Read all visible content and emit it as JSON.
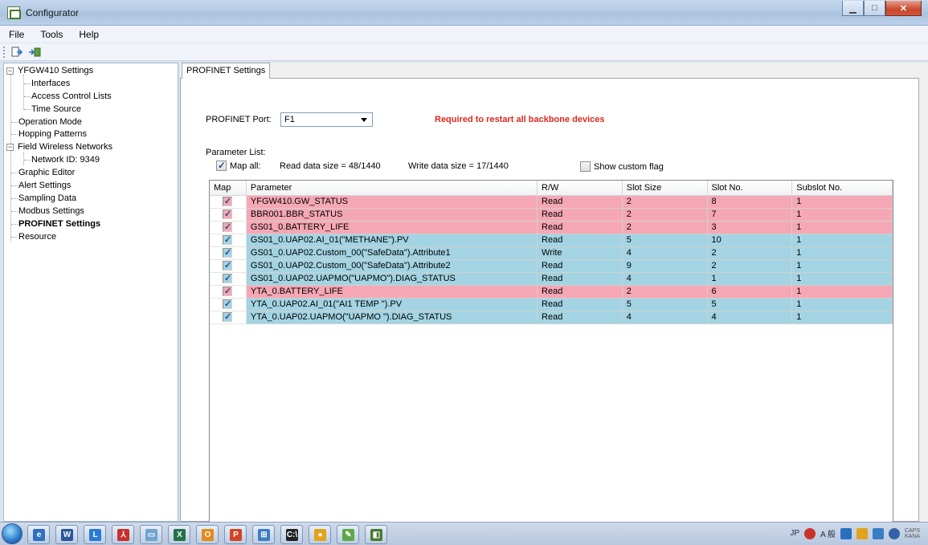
{
  "window": {
    "title": "Configurator",
    "min_icon": "minimize-icon",
    "max_icon": "maximize-icon",
    "close_icon": "close-icon"
  },
  "menu": [
    "File",
    "Tools",
    "Help"
  ],
  "toolbar": {
    "icons": [
      "import-icon",
      "export-icon"
    ]
  },
  "tree": {
    "items": [
      {
        "label": "YFGW410 Settings",
        "expander": "−"
      },
      {
        "label": "Interfaces"
      },
      {
        "label": "Access Control Lists"
      },
      {
        "label": "Time Source"
      },
      {
        "label": "Operation Mode"
      },
      {
        "label": "Hopping Patterns"
      },
      {
        "label": "Field Wireless Networks",
        "expander": "−"
      },
      {
        "label": "Network ID: 9349"
      },
      {
        "label": "Graphic Editor"
      },
      {
        "label": "Alert Settings"
      },
      {
        "label": "Sampling Data"
      },
      {
        "label": "Modbus Settings"
      },
      {
        "label": "PROFINET Settings",
        "selected": true
      },
      {
        "label": "Resource"
      }
    ]
  },
  "tab": {
    "label": "PROFINET Settings"
  },
  "profinet": {
    "port_label": "PROFINET Port:",
    "port_value": "F1",
    "warning": "Required to restart all backbone devices",
    "param_list_label": "Parameter List:",
    "map_all_label": "Map all:",
    "map_all_checked": true,
    "read_size": "Read data size =  48/1440",
    "write_size": "Write data size =  17/1440",
    "custom_flag_label": "Show custom flag",
    "custom_flag_checked": false
  },
  "table": {
    "headers": [
      "Map",
      "Parameter",
      "R/W",
      "Slot Size",
      "Slot No.",
      "Subslot No."
    ],
    "rows": [
      {
        "param": "YFGW410.GW_STATUS",
        "rw": "Read",
        "size": "2",
        "slot": "8",
        "sub": "1",
        "color": "pink"
      },
      {
        "param": "BBR001.BBR_STATUS",
        "rw": "Read",
        "size": "2",
        "slot": "7",
        "sub": "1",
        "color": "pink"
      },
      {
        "param": "GS01_0.BATTERY_LIFE",
        "rw": "Read",
        "size": "2",
        "slot": "3",
        "sub": "1",
        "color": "pink"
      },
      {
        "param": "GS01_0.UAP02.AI_01(\"METHANE\").PV",
        "rw": "Read",
        "size": "5",
        "slot": "10",
        "sub": "1",
        "color": "blue"
      },
      {
        "param": "GS01_0.UAP02.Custom_00(\"SafeData\").Attribute1",
        "rw": "Write",
        "size": "4",
        "slot": "2",
        "sub": "1",
        "color": "blue"
      },
      {
        "param": "GS01_0.UAP02.Custom_00(\"SafeData\").Attribute2",
        "rw": "Read",
        "size": "9",
        "slot": "2",
        "sub": "1",
        "color": "blue"
      },
      {
        "param": "GS01_0.UAP02.UAPMO(\"UAPMO\").DIAG_STATUS",
        "rw": "Read",
        "size": "4",
        "slot": "1",
        "sub": "1",
        "color": "blue"
      },
      {
        "param": "YTA_0.BATTERY_LIFE",
        "rw": "Read",
        "size": "2",
        "slot": "6",
        "sub": "1",
        "color": "pink"
      },
      {
        "param": "YTA_0.UAP02.AI_01(\"AI1 TEMP    \").PV",
        "rw": "Read",
        "size": "5",
        "slot": "5",
        "sub": "1",
        "color": "blue"
      },
      {
        "param": "YTA_0.UAP02.UAPMO(\"UAPMO \").DIAG_STATUS",
        "rw": "Read",
        "size": "4",
        "slot": "4",
        "sub": "1",
        "color": "blue"
      }
    ]
  },
  "taskbar": {
    "apps": [
      {
        "name": "ie-icon",
        "glyph": "e",
        "color": "#2f6fbf"
      },
      {
        "name": "word-icon",
        "glyph": "W",
        "color": "#2b579a"
      },
      {
        "name": "lync-icon",
        "glyph": "L",
        "color": "#2a7ad6"
      },
      {
        "name": "acrobat-icon",
        "glyph": "⅄",
        "color": "#c9302c"
      },
      {
        "name": "explorer-icon",
        "glyph": "▭",
        "color": "#6fa2cf"
      },
      {
        "name": "excel-icon",
        "glyph": "X",
        "color": "#217346"
      },
      {
        "name": "outlook-icon",
        "glyph": "O",
        "color": "#e48a1a"
      },
      {
        "name": "powerpoint-icon",
        "glyph": "P",
        "color": "#d04525"
      },
      {
        "name": "network-icon",
        "glyph": "⊞",
        "color": "#3a7dc4"
      },
      {
        "name": "cmd-icon",
        "glyph": "C:\\",
        "color": "#222"
      },
      {
        "name": "chrome-icon",
        "glyph": "●",
        "color": "#e3a21a"
      },
      {
        "name": "paint-icon",
        "glyph": "✎",
        "color": "#5ea84a"
      },
      {
        "name": "configurator-icon",
        "glyph": "◧",
        "color": "#4a7a32"
      }
    ],
    "tray_lang": "JP",
    "tray_ime": "A 般",
    "caps": "CAPS",
    "kana": "KANA"
  }
}
